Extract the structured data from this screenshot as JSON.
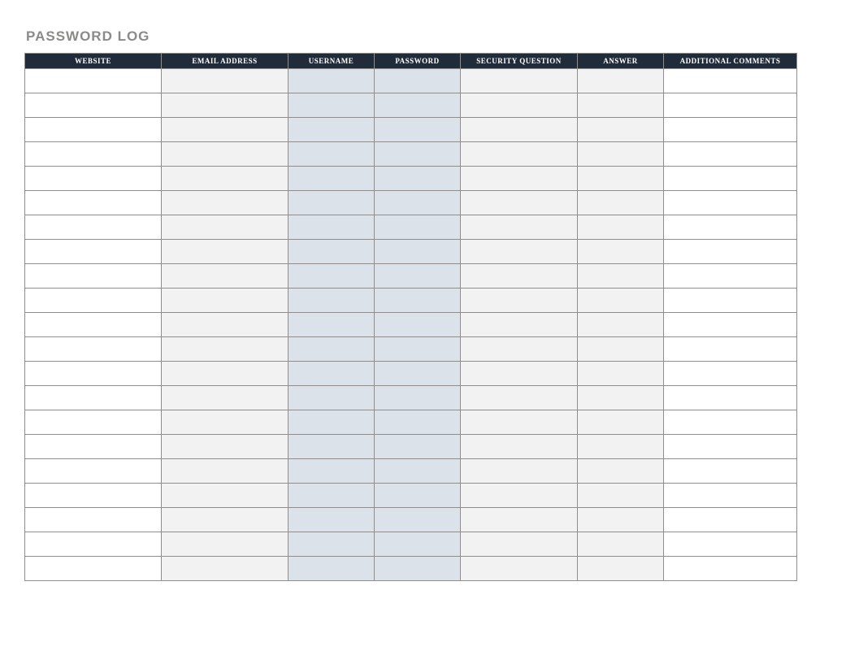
{
  "title": "PASSWORD LOG",
  "columns": [
    {
      "label": "WEBSITE",
      "fill": "white"
    },
    {
      "label": "EMAIL ADDRESS",
      "fill": "gray"
    },
    {
      "label": "USERNAME",
      "fill": "blue"
    },
    {
      "label": "PASSWORD",
      "fill": "blue"
    },
    {
      "label": "SECURITY QUESTION",
      "fill": "gray"
    },
    {
      "label": "ANSWER",
      "fill": "gray"
    },
    {
      "label": "ADDITIONAL COMMENTS",
      "fill": "white"
    }
  ],
  "rows": [
    {
      "website": "",
      "email": "",
      "username": "",
      "password": "",
      "security": "",
      "answer": "",
      "comments": ""
    },
    {
      "website": "",
      "email": "",
      "username": "",
      "password": "",
      "security": "",
      "answer": "",
      "comments": ""
    },
    {
      "website": "",
      "email": "",
      "username": "",
      "password": "",
      "security": "",
      "answer": "",
      "comments": ""
    },
    {
      "website": "",
      "email": "",
      "username": "",
      "password": "",
      "security": "",
      "answer": "",
      "comments": ""
    },
    {
      "website": "",
      "email": "",
      "username": "",
      "password": "",
      "security": "",
      "answer": "",
      "comments": ""
    },
    {
      "website": "",
      "email": "",
      "username": "",
      "password": "",
      "security": "",
      "answer": "",
      "comments": ""
    },
    {
      "website": "",
      "email": "",
      "username": "",
      "password": "",
      "security": "",
      "answer": "",
      "comments": ""
    },
    {
      "website": "",
      "email": "",
      "username": "",
      "password": "",
      "security": "",
      "answer": "",
      "comments": ""
    },
    {
      "website": "",
      "email": "",
      "username": "",
      "password": "",
      "security": "",
      "answer": "",
      "comments": ""
    },
    {
      "website": "",
      "email": "",
      "username": "",
      "password": "",
      "security": "",
      "answer": "",
      "comments": ""
    },
    {
      "website": "",
      "email": "",
      "username": "",
      "password": "",
      "security": "",
      "answer": "",
      "comments": ""
    },
    {
      "website": "",
      "email": "",
      "username": "",
      "password": "",
      "security": "",
      "answer": "",
      "comments": ""
    },
    {
      "website": "",
      "email": "",
      "username": "",
      "password": "",
      "security": "",
      "answer": "",
      "comments": ""
    },
    {
      "website": "",
      "email": "",
      "username": "",
      "password": "",
      "security": "",
      "answer": "",
      "comments": ""
    },
    {
      "website": "",
      "email": "",
      "username": "",
      "password": "",
      "security": "",
      "answer": "",
      "comments": ""
    },
    {
      "website": "",
      "email": "",
      "username": "",
      "password": "",
      "security": "",
      "answer": "",
      "comments": ""
    },
    {
      "website": "",
      "email": "",
      "username": "",
      "password": "",
      "security": "",
      "answer": "",
      "comments": ""
    },
    {
      "website": "",
      "email": "",
      "username": "",
      "password": "",
      "security": "",
      "answer": "",
      "comments": ""
    },
    {
      "website": "",
      "email": "",
      "username": "",
      "password": "",
      "security": "",
      "answer": "",
      "comments": ""
    },
    {
      "website": "",
      "email": "",
      "username": "",
      "password": "",
      "security": "",
      "answer": "",
      "comments": ""
    },
    {
      "website": "",
      "email": "",
      "username": "",
      "password": "",
      "security": "",
      "answer": "",
      "comments": ""
    }
  ],
  "colors": {
    "header_bg": "#212c3b",
    "header_text": "#ffffff",
    "title_text": "#8a8a88",
    "cell_white": "#ffffff",
    "cell_gray": "#f2f2f2",
    "cell_blue": "#dbe2ea",
    "border": "#8e8e8e"
  }
}
